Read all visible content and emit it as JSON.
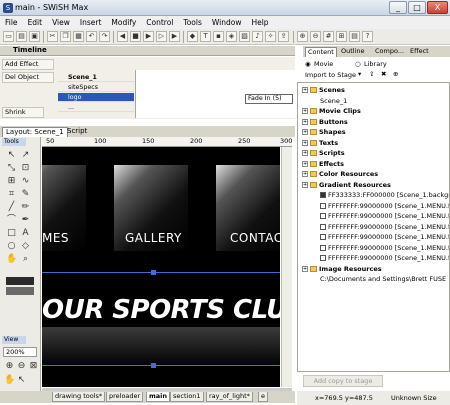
{
  "window": {
    "title": "main - SWiSH Max",
    "min": "_",
    "max": "□",
    "close": "X"
  },
  "menu": [
    "File",
    "Edit",
    "View",
    "Insert",
    "Modify",
    "Control",
    "Tools",
    "Window",
    "Help"
  ],
  "timeline": {
    "label": "Timeline",
    "add_effect": "Add Effect",
    "del_object": "Del Object",
    "shrink": "Shrink",
    "rows": [
      "Scene_1",
      "siteSpecs",
      "logo",
      "..."
    ],
    "fade_label": "Fade In (5)"
  },
  "layout": {
    "tab_active": "Layout: Scene_1",
    "tab_script": "Script",
    "ruler": [
      "50",
      "100",
      "150",
      "200",
      "250",
      "300"
    ],
    "tools_label": "Tools",
    "view_label": "View",
    "zoom": "200%",
    "nav_items": [
      "MES",
      "GALLERY",
      "CONTAC"
    ],
    "headline": "OUR SPORTS CLUB"
  },
  "bottom_tabs": [
    "drawing tools*",
    "preloader",
    "main",
    "section1",
    "ray_of_light*",
    "e"
  ],
  "right_panel": {
    "tabs": [
      "Content",
      "Outline",
      "Compo...",
      "Effect"
    ],
    "radio_movie": "Movie",
    "radio_library": "Library",
    "import": "Import to Stage",
    "tree": [
      {
        "label": "Scenes",
        "bold": true,
        "folder": true
      },
      {
        "label": "Scene_1",
        "bold": false,
        "indent": 1
      },
      {
        "label": "Movie Clips",
        "bold": true,
        "folder": true
      },
      {
        "label": "Buttons",
        "bold": true,
        "folder": true
      },
      {
        "label": "Shapes",
        "bold": true,
        "folder": true
      },
      {
        "label": "Texts",
        "bold": true,
        "folder": true
      },
      {
        "label": "Scripts",
        "bold": true,
        "folder": true
      },
      {
        "label": "Effects",
        "bold": true,
        "folder": true
      },
      {
        "label": "Color Resources",
        "bold": true,
        "folder": true
      },
      {
        "label": "Gradient Resources",
        "bold": true,
        "folder": true
      },
      {
        "label": "FF333333:FF000000 [Scene_1.backgr",
        "swatch": "#333333",
        "indent": 1
      },
      {
        "label": "FFFFFFFF:99000000 [Scene_1.MENU.f",
        "swatch": "#ffffff",
        "indent": 1
      },
      {
        "label": "FFFFFFFF:99000000 [Scene_1.MENU.f",
        "swatch": "#ffffff",
        "indent": 1
      },
      {
        "label": "FFFFFFFF:99000000 [Scene_1.MENU.f",
        "swatch": "#ffffff",
        "indent": 1
      },
      {
        "label": "FFFFFFFF:99000000 [Scene_1.MENU.f",
        "swatch": "#ffffff",
        "indent": 1
      },
      {
        "label": "FFFFFFFF:99000000 [Scene_1.MENU.f",
        "swatch": "#ffffff",
        "indent": 1
      },
      {
        "label": "FFFFFFFF:99000000 [Scene_1.MENU.f",
        "swatch": "#ffffff",
        "indent": 1
      },
      {
        "label": "Image Resources",
        "bold": true,
        "folder": true
      },
      {
        "label": "C:\\Documents and Settings\\Brett FUSE",
        "bold": false,
        "indent": 1
      }
    ],
    "copy_button": "Add copy to stage"
  },
  "status": {
    "coords": "x=769.5 y=487.5",
    "size": "Unknown Size"
  }
}
